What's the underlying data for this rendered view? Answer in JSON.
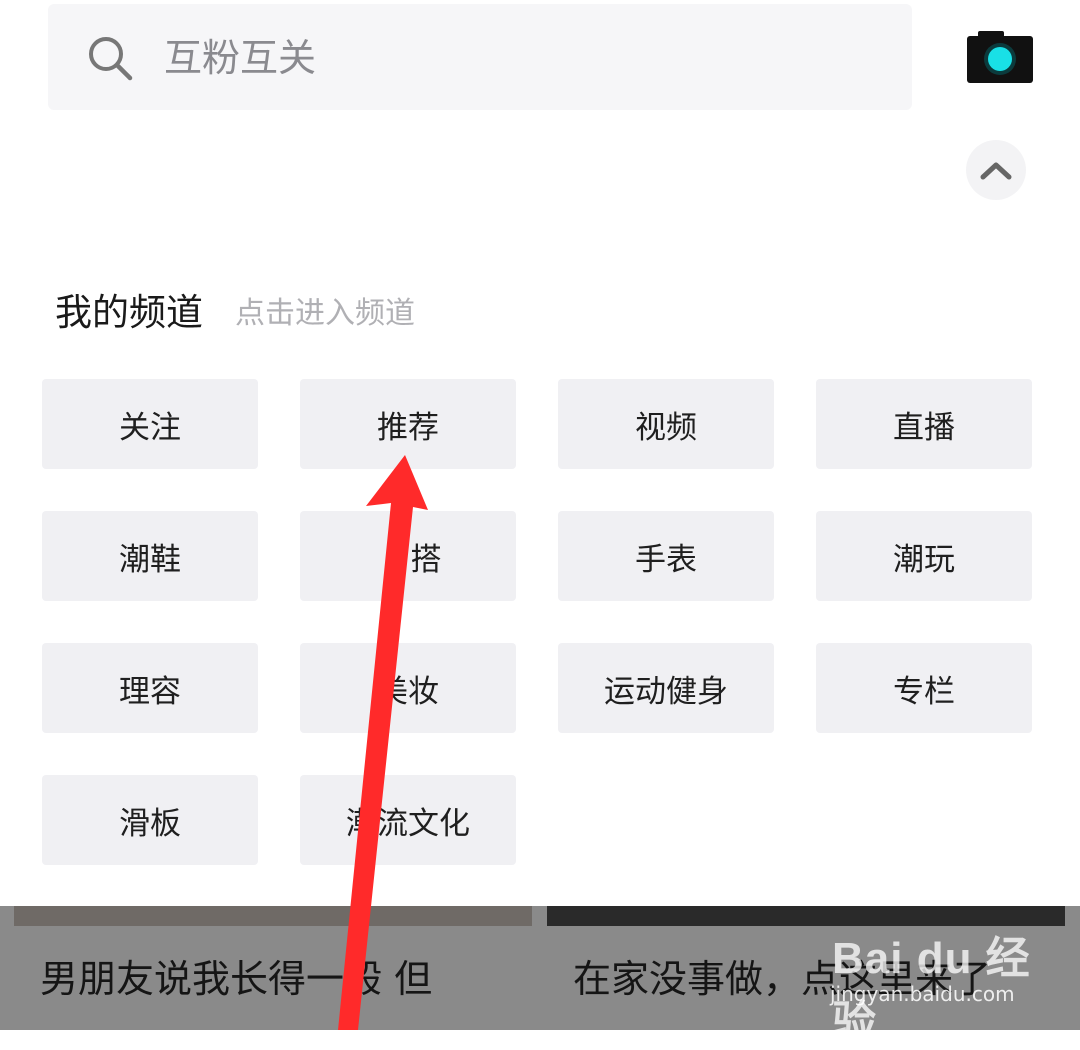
{
  "search": {
    "placeholder": "互粉互关"
  },
  "channels": {
    "title": "我的频道",
    "hint": "点击进入频道",
    "items": [
      "关注",
      "推荐",
      "视频",
      "直播",
      "潮鞋",
      "搭",
      "手表",
      "潮玩",
      "理容",
      "美妆",
      "运动健身",
      "专栏",
      "滑板",
      "潮流文化"
    ]
  },
  "feed": {
    "cards": [
      {
        "title": "男朋友说我长得一般 但"
      },
      {
        "title": "在家没事做，点这里来了"
      }
    ]
  },
  "watermark": {
    "brand": "Bai du 经验",
    "url": "jingyan.baidu.com"
  },
  "colors": {
    "chip_bg": "#f0f0f3",
    "annotation_arrow": "#ff2a2a",
    "camera_lens": "#19e0e6"
  },
  "icons": {
    "search": "search-icon",
    "camera": "camera-icon",
    "collapse": "chevron-up-icon"
  }
}
